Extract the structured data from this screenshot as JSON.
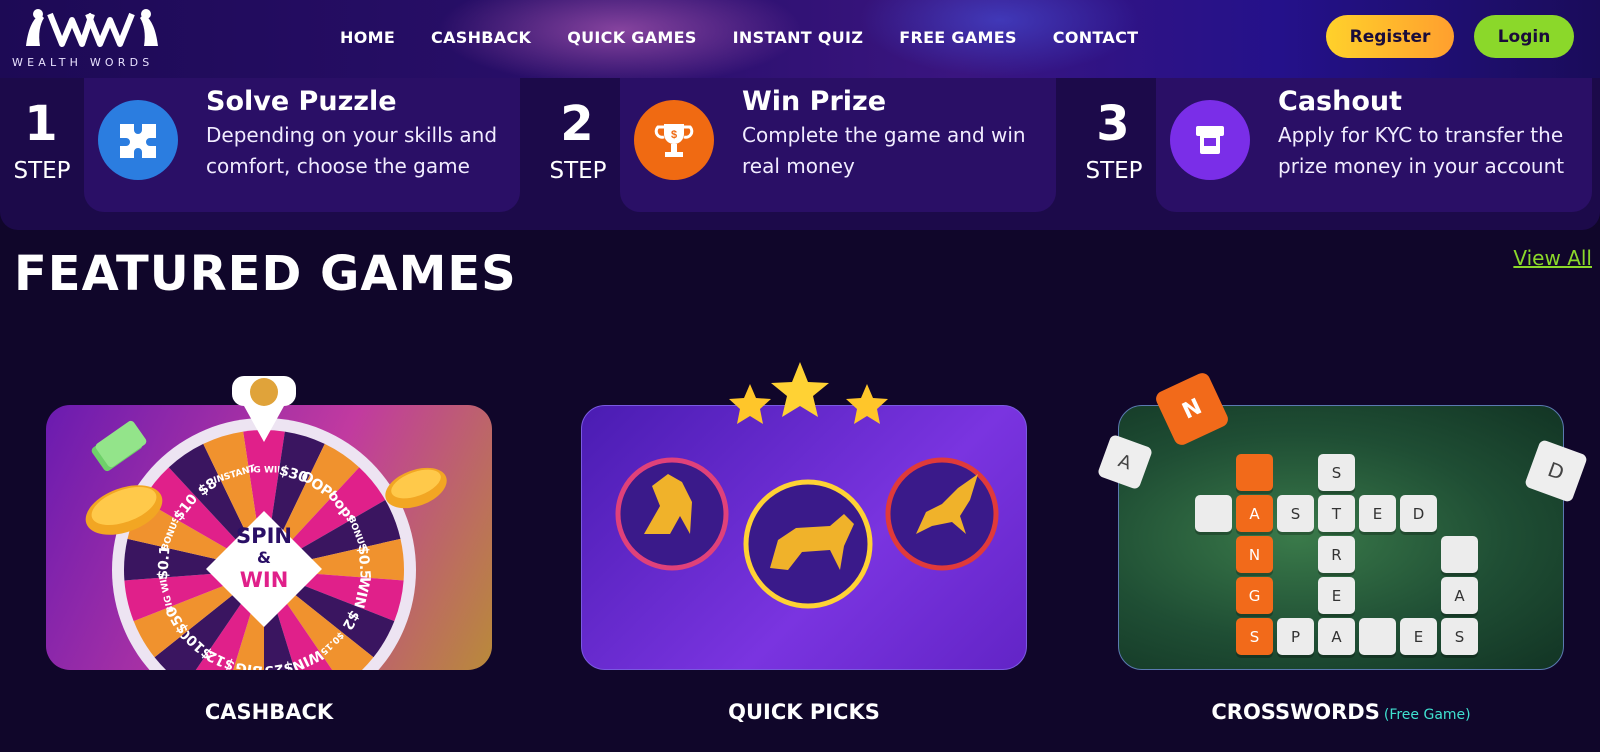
{
  "brand": {
    "name": "WEALTH WORDS"
  },
  "nav": {
    "items": [
      "HOME",
      "CASHBACK",
      "QUICK GAMES",
      "INSTANT QUIZ",
      "FREE GAMES",
      "CONTACT"
    ],
    "register": "Register",
    "login": "Login"
  },
  "steps": [
    {
      "num": "1",
      "word": "STEP",
      "title": "Solve Puzzle",
      "desc": "Depending on your skills and comfort, choose the game",
      "icon": "puzzle-icon"
    },
    {
      "num": "2",
      "word": "STEP",
      "title": "Win Prize",
      "desc": "Complete the game and win real money",
      "icon": "trophy-icon"
    },
    {
      "num": "3",
      "word": "STEP",
      "title": "Cashout",
      "desc": "Apply for KYC to transfer the prize money in your account",
      "icon": "atm-icon"
    }
  ],
  "featured": {
    "title": "FEATURED GAMES",
    "view_all": "View All",
    "games": [
      {
        "label": "CASHBACK",
        "tag": ""
      },
      {
        "label": "QUICK PICKS",
        "tag": ""
      },
      {
        "label": "CROSSWORDS",
        "tag": "(Free Game)"
      }
    ]
  },
  "wheel": {
    "center_top": "SPIN",
    "center_mid": "&",
    "center_bottom": "WIN",
    "segments": [
      "BIG WIN",
      "$30",
      "OOPS",
      "oops",
      "BONUS",
      "$0.5",
      "WIN",
      "$2",
      "$0.15",
      "WIN",
      "$25",
      "BIG",
      "$12",
      "$100",
      "$50",
      "BIG WIN",
      "$0.1",
      "BONUS",
      "$10",
      "$8",
      "INSTANT"
    ]
  },
  "crossword": {
    "tiles": [
      "S",
      "A",
      "S",
      "T",
      "E",
      "D",
      "N",
      "R",
      "G",
      "E",
      "A",
      "S",
      "P",
      "A",
      "E",
      "S"
    ],
    "floating": [
      "N",
      "A",
      "D"
    ]
  },
  "colors": {
    "accent_green": "#8bd82a",
    "accent_yellow": "#ffd12b",
    "bg": "#10062a",
    "free_tag": "#3fe0d0"
  }
}
